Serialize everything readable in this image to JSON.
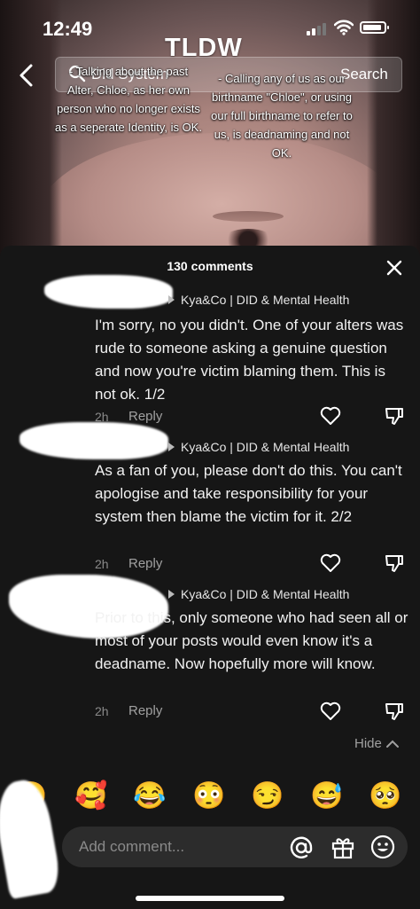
{
  "status_bar": {
    "time": "12:49"
  },
  "header": {
    "overlay_title": "TLDW",
    "search_query": "Did System",
    "search_button": "Search"
  },
  "video": {
    "caption_left": "- Talking about the past Alter, Chloe, as her own person who no longer exists as a seperate Identity, is OK.",
    "caption_right": "- Calling any of us as our birthname \"Chloe\", or using our full birthname to refer to us, is deadnaming and not OK."
  },
  "comments_panel": {
    "count_label": "130 comments",
    "hide_label": "Hide",
    "comments": [
      {
        "reply_to": "Kya&Co | DID & Mental Health",
        "text": "I'm sorry, no you didn't. One of your alters was rude to someone asking a genuine question and now you're victim blaming them. This is not ok. 1/2",
        "time": "2h",
        "reply_label": "Reply"
      },
      {
        "reply_to": "Kya&Co | DID & Mental Health",
        "text": "As a fan of you, please don't do this. You can't apologise and take responsibility for your system then blame the victim for it. 2/2",
        "time": "2h",
        "reply_label": "Reply"
      },
      {
        "reply_to": "Kya&Co | DID & Mental Health",
        "text": "Prior to this, only someone who had seen all or most of your posts would even know it's a deadname. Now hopefully more will know.",
        "time": "2h",
        "reply_label": "Reply"
      }
    ]
  },
  "emoji_bar": [
    "😁",
    "🥰",
    "😂",
    "😳",
    "😏",
    "😅",
    "🥺"
  ],
  "composer": {
    "placeholder": "Add comment..."
  },
  "icons": {
    "back": "chevron-left-icon",
    "search": "search-icon",
    "close": "close-icon",
    "like": "heart-icon",
    "dislike": "thumbs-down-icon",
    "mention": "at-icon",
    "gift": "gift-icon",
    "emoji": "smile-icon"
  }
}
